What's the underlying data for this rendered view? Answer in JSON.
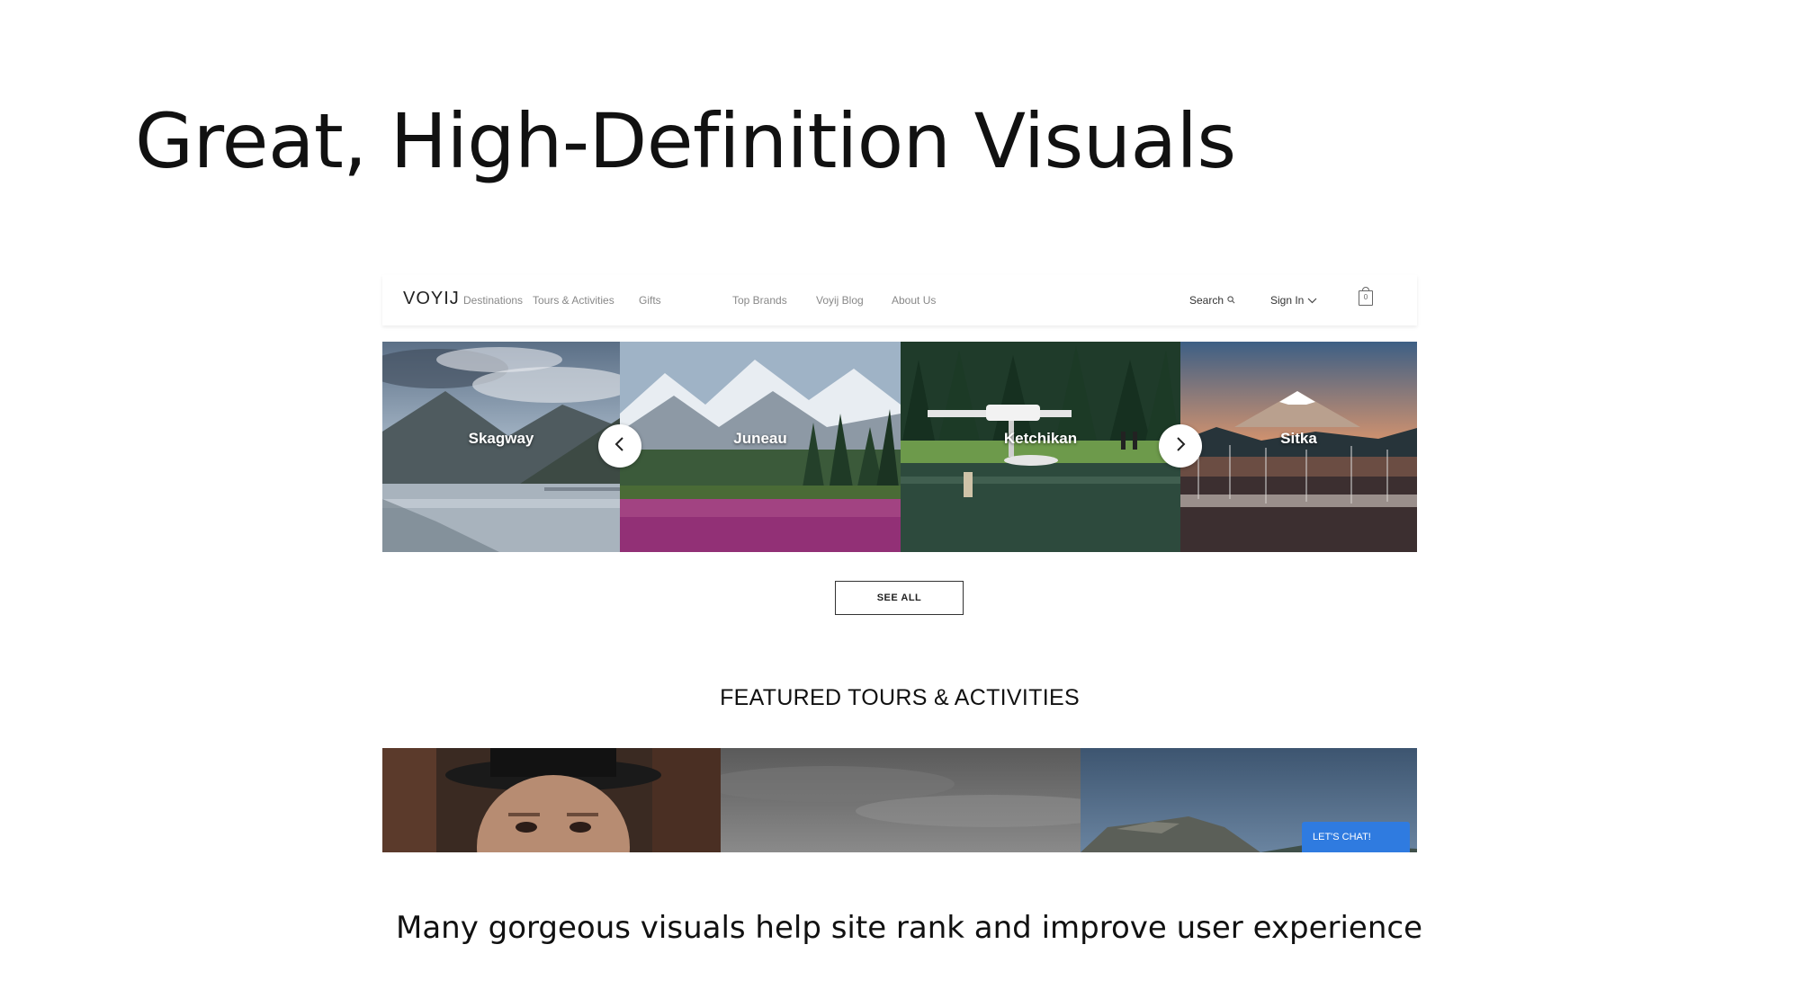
{
  "slide": {
    "title": "Great, High-Definition Visuals",
    "caption": "Many gorgeous visuals help site rank and improve user experience"
  },
  "site": {
    "logo": "VOYIJ",
    "nav": [
      "Destinations",
      "Tours & Activities",
      "Gifts",
      "Top Brands",
      "Voyij Blog",
      "About Us"
    ],
    "search_label": "Search",
    "signin_label": "Sign In",
    "cart_count": "0",
    "destinations": [
      "Skagway",
      "Juneau",
      "Ketchikan",
      "Sitka"
    ],
    "see_all_label": "SEE ALL",
    "featured_heading": "FEATURED TOURS & ACTIVITIES",
    "chat_label": "LET'S CHAT!",
    "icons": {
      "search": "search-icon",
      "signin": "chevron-down-icon",
      "cart": "shopping-bag-icon",
      "prev": "chevron-left-icon",
      "next": "chevron-right-icon"
    },
    "colors": {
      "chat_button": "#2f7be0",
      "nav_text": "#888888"
    }
  }
}
